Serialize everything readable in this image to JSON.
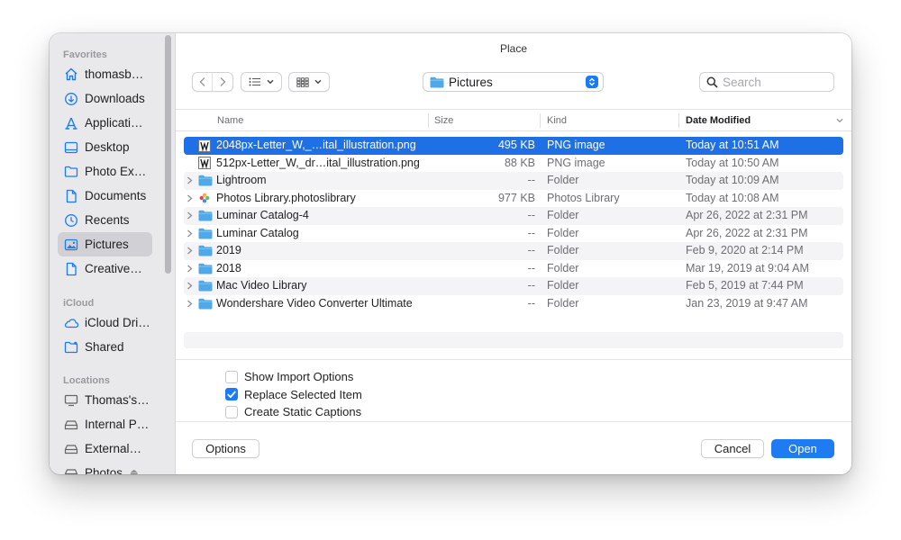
{
  "window": {
    "title": "Place"
  },
  "sidebar": {
    "sections": [
      {
        "label": "Favorites"
      },
      {
        "label": "iCloud"
      },
      {
        "label": "Locations"
      }
    ],
    "items": [
      {
        "label": "thomasb…",
        "icon": "home-icon"
      },
      {
        "label": "Downloads",
        "icon": "download-icon"
      },
      {
        "label": "Applicati…",
        "icon": "applications-icon"
      },
      {
        "label": "Desktop",
        "icon": "desktop-icon"
      },
      {
        "label": "Photo Ex…",
        "icon": "folder-icon"
      },
      {
        "label": "Documents",
        "icon": "document-icon"
      },
      {
        "label": "Recents",
        "icon": "clock-icon"
      },
      {
        "label": "Pictures",
        "icon": "pictures-icon",
        "selected": true
      },
      {
        "label": "Creative…",
        "icon": "document-icon"
      },
      {
        "label": "iCloud Dri…",
        "icon": "cloud-icon"
      },
      {
        "label": "Shared",
        "icon": "shared-folder-icon"
      },
      {
        "label": "Thomas's…",
        "icon": "computer-icon"
      },
      {
        "label": "Internal P…",
        "icon": "drive-icon"
      },
      {
        "label": "External…",
        "icon": "drive-icon"
      },
      {
        "label": "Photos",
        "icon": "drive-icon"
      }
    ]
  },
  "toolbar": {
    "location": "Pictures",
    "search_placeholder": "Search"
  },
  "table": {
    "columns": [
      "Name",
      "Size",
      "Kind",
      "Date Modified"
    ],
    "sorted_column": "Date Modified",
    "rows": [
      {
        "name": "2048px-Letter_W,_…ital_illustration.png",
        "size": "495 KB",
        "kind": "PNG image",
        "date": "Today at 10:51 AM",
        "icon": "png-file-icon",
        "expandable": false,
        "selected": true
      },
      {
        "name": "512px-Letter_W,_dr…ital_illustration.png",
        "size": "88 KB",
        "kind": "PNG image",
        "date": "Today at 10:50 AM",
        "icon": "png-file-icon",
        "expandable": false
      },
      {
        "name": "Lightroom",
        "size": "--",
        "kind": "Folder",
        "date": "Today at 10:09 AM",
        "icon": "folder-icon",
        "expandable": true
      },
      {
        "name": "Photos Library.photoslibrary",
        "size": "977 KB",
        "kind": "Photos Library",
        "date": "Today at 10:08 AM",
        "icon": "photos-library-icon",
        "expandable": true
      },
      {
        "name": "Luminar Catalog-4",
        "size": "--",
        "kind": "Folder",
        "date": "Apr 26, 2022 at 2:31 PM",
        "icon": "folder-icon",
        "expandable": true
      },
      {
        "name": "Luminar Catalog",
        "size": "--",
        "kind": "Folder",
        "date": "Apr 26, 2022 at 2:31 PM",
        "icon": "folder-icon",
        "expandable": true
      },
      {
        "name": "2019",
        "size": "--",
        "kind": "Folder",
        "date": "Feb 9, 2020 at 2:14 PM",
        "icon": "folder-icon",
        "expandable": true
      },
      {
        "name": "2018",
        "size": "--",
        "kind": "Folder",
        "date": "Mar 19, 2019 at 9:04 AM",
        "icon": "folder-icon",
        "expandable": true
      },
      {
        "name": "Mac Video Library",
        "size": "--",
        "kind": "Folder",
        "date": "Feb 5, 2019 at 7:44 PM",
        "icon": "folder-icon",
        "expandable": true
      },
      {
        "name": "Wondershare Video Converter Ultimate",
        "size": "--",
        "kind": "Folder",
        "date": "Jan 23, 2019 at 9:47 AM",
        "icon": "folder-icon",
        "expandable": true
      }
    ]
  },
  "options": [
    {
      "label": "Show Import Options",
      "checked": false
    },
    {
      "label": "Replace Selected Item",
      "checked": true
    },
    {
      "label": "Create Static Captions",
      "checked": false
    }
  ],
  "footer": {
    "options_label": "Options",
    "cancel_label": "Cancel",
    "open_label": "Open"
  },
  "colors": {
    "accent": "#1f7bf2",
    "selection": "#1f6fe5",
    "folder": "#4fa9e8",
    "sidebar_bg": "#e9e8ea"
  }
}
